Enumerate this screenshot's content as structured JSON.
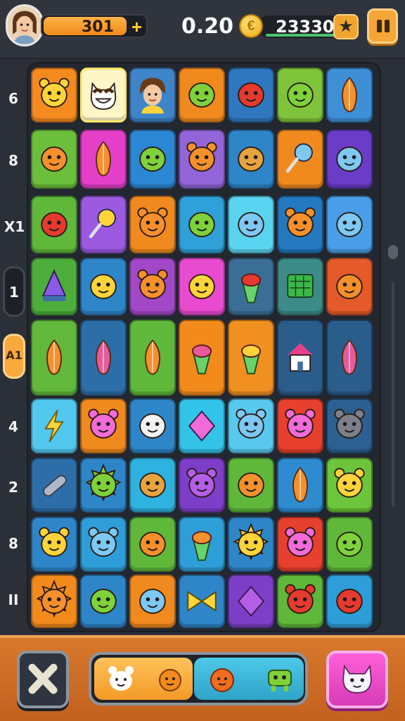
{
  "hud": {
    "player_level": "301",
    "level_plus": "+",
    "timer": "0.20",
    "coin_symbol": "€",
    "coins": "23330",
    "star_icon": "star-icon"
  },
  "left_rail": {
    "labels": [
      "6",
      "8",
      "X1",
      "1",
      "4",
      "2",
      "8",
      "II"
    ],
    "active_button_text": "1",
    "orange_button_text": "A1"
  },
  "board": {
    "columns": 7,
    "rows": 9,
    "tiles": [
      [
        "#f58a1f",
        "#fff6c8",
        "#3d84c8",
        "#f0891e",
        "#2f78bf",
        "#7ec43a",
        "#3d8fd6"
      ],
      [
        "#6cbf3a",
        "#e43fc8",
        "#2b86d3",
        "#9266d8",
        "#2e86c8",
        "#f0891e",
        "#6a3cc8"
      ],
      [
        "#5fb83a",
        "#9b5ae0",
        "#f0891e",
        "#2fa0d8",
        "#59d4f0",
        "#2478c0",
        "#4a9ee8"
      ],
      [
        "#4eae3c",
        "#2e86c8",
        "#a148c9",
        "#e84ad0",
        "#3b6e94",
        "#3b8c88",
        "#e45a2a"
      ],
      [
        "#62b83a",
        "#2c6fa8",
        "#5fb83a",
        "#f28a1c",
        "#f09020",
        "#2a5d8c",
        "#2a5d8c"
      ],
      [
        "#52c8ee",
        "#f0891e",
        "#2e86c8",
        "#33c2e8",
        "#58c8ee",
        "#e8402e",
        "#2c5f92"
      ],
      [
        "#2d6ea8",
        "#2e86c8",
        "#2eb2e0",
        "#7d3fc8",
        "#5fb83a",
        "#2f8bd0",
        "#6cc53a"
      ],
      [
        "#2e86c8",
        "#2e9ed8",
        "#5fb83a",
        "#2e9ed8",
        "#2e86c8",
        "#e8402e",
        "#5fb83a"
      ],
      [
        "#f28a1c",
        "#2e86c8",
        "#f0891e",
        "#2e86c8",
        "#7d3fc8",
        "#5fb83a",
        "#2e9ed8"
      ]
    ],
    "sprites": [
      [
        "cat-face",
        "smiling-cat-face",
        "boy-avatar",
        "green-alien",
        "red-tomato",
        "green-apple",
        "carrot-slice"
      ],
      [
        "orange-drop",
        "orange-leaf",
        "green-blob",
        "orange-bear",
        "bread-loaf",
        "blue-spoon",
        "blue-crowned-blob"
      ],
      [
        "red-mushroom",
        "magnifier",
        "orange-bear",
        "green-pepper",
        "yellow-drop",
        "orange-fox",
        "blue-ghost"
      ],
      [
        "rainbow-pyramid",
        "yellow-blob",
        "orange-bear",
        "cyan-candy",
        "red-cone",
        "green-box",
        "orange-ball"
      ],
      [
        "rainbow-carrot",
        "rainbow-feather",
        "orange-carrot",
        "striped-cone",
        "ice-cream",
        "pink-house",
        "rainbow-feather-2"
      ],
      [
        "lightning-bolt",
        "pink-cat",
        "white-cloud",
        "pink-diamond",
        "blue-bear",
        "pink-monster",
        "grey-cat"
      ],
      [
        "purple-pill",
        "green-spiky-blob",
        "cheese-block",
        "purple-bear",
        "orange-blob",
        "orange-carrot-2",
        "yellow-cat"
      ],
      [
        "yellow-bear",
        "blue-bear",
        "orange-drop",
        "orange-ice-pop",
        "yellow-spiky-blob",
        "pink-cat",
        "green-apple-2"
      ],
      [
        "orange-star",
        "green-frog",
        "blue-drop",
        "yellow-bow",
        "purple-diamond",
        "red-bear",
        "red-tomato"
      ]
    ]
  },
  "bottom_bar": {
    "close_icon": "close-icon",
    "tray_icons": [
      "white-bear-icon",
      "orange-spiky-icon",
      "orange-fox-icon",
      "green-alien-icon"
    ],
    "pink_button_icon": "white-cat-icon"
  }
}
